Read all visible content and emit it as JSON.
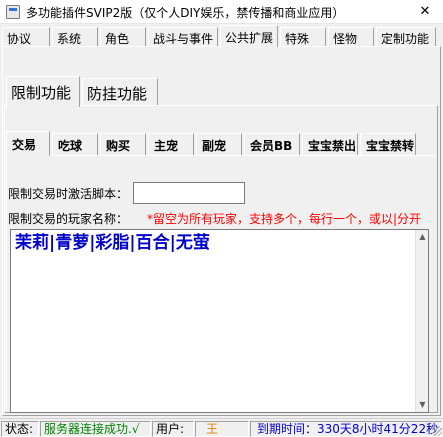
{
  "window": {
    "title": "多功能插件SVIP2版（仅个人DIY娱乐，禁传播和商业应用）",
    "close_glyph": "✕"
  },
  "top_tabs": [
    {
      "label": "协议"
    },
    {
      "label": "系统"
    },
    {
      "label": "角色"
    },
    {
      "label": "战斗与事件"
    },
    {
      "label": "公共扩展"
    },
    {
      "label": "特殊"
    },
    {
      "label": "怪物"
    },
    {
      "label": "定制功能"
    }
  ],
  "top_tabs_active": "公共扩展",
  "second_tabs": [
    {
      "label": "限制功能"
    },
    {
      "label": "防挂功能"
    }
  ],
  "second_tabs_active": "限制功能",
  "third_tabs": [
    {
      "label": "交易"
    },
    {
      "label": "吃球"
    },
    {
      "label": "购买"
    },
    {
      "label": "主宠"
    },
    {
      "label": "副宠"
    },
    {
      "label": "会员BB"
    },
    {
      "label": "宝宝禁出"
    },
    {
      "label": "宝宝禁转"
    }
  ],
  "third_tabs_active": "交易",
  "form": {
    "script_label": "限制交易时激活脚本：",
    "script_value": "",
    "players_label": "限制交易的玩家名称：",
    "players_hint": "*留空为所有玩家，支持多个，每行一个，或以|分开",
    "players_value": "茉莉|青萝|彩脂|百合|无萤"
  },
  "statusbar": {
    "status_label": "状态:",
    "status_text": "服务器连接成功.√",
    "user_label": "用户:",
    "user_name": "王",
    "expire_text": "到期时间：330天8小时41分22秒"
  },
  "colors": {
    "hint": "#ff0000",
    "players_text": "#0000cc",
    "status_ok": "#008000",
    "user_name": "#e08000",
    "expire": "#0000cc"
  }
}
